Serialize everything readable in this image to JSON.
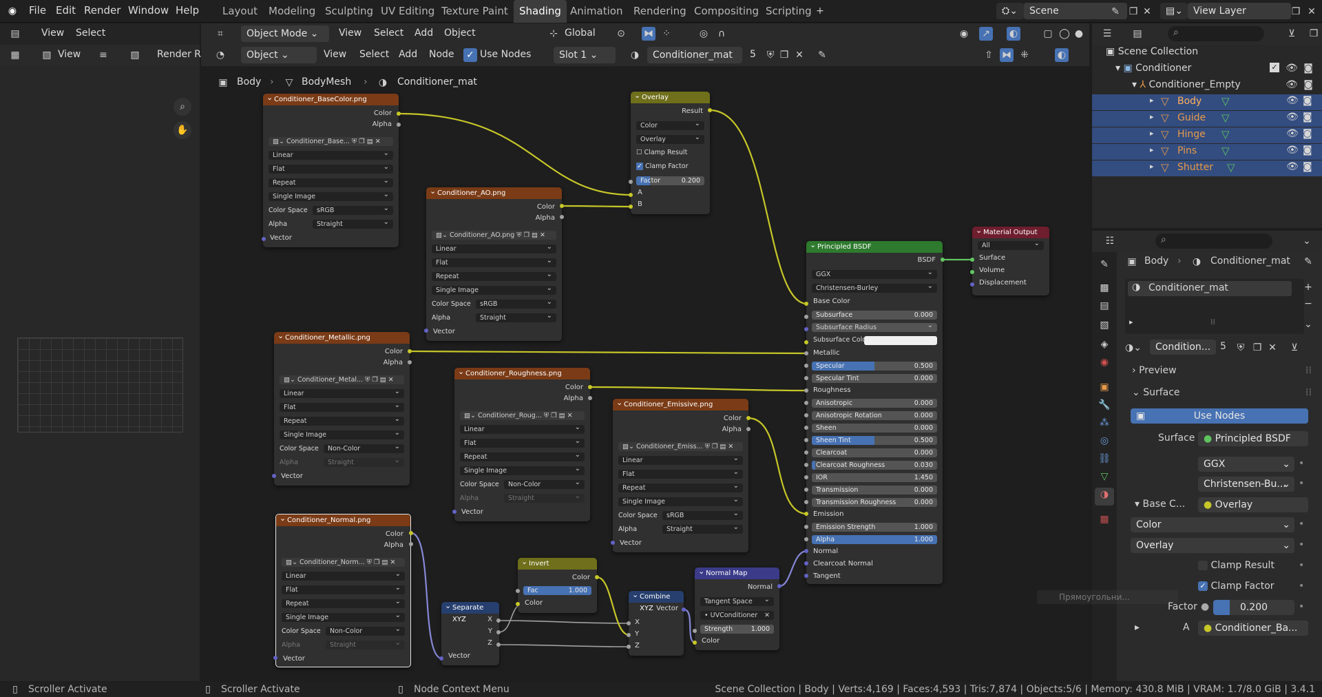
{
  "menu": {
    "file": "File",
    "edit": "Edit",
    "render": "Render",
    "window": "Window",
    "help": "Help"
  },
  "workspaces": [
    "Layout",
    "Modeling",
    "Sculpting",
    "UV Editing",
    "Texture Paint",
    "Shading",
    "Animation",
    "Rendering",
    "Compositing",
    "Scripting"
  ],
  "active_workspace": "Shading",
  "scene": {
    "label": "Scene",
    "view_layer": "View Layer"
  },
  "left_header": {
    "view": "View",
    "select": "Select",
    "view2": "View",
    "render_result": "Render Re"
  },
  "viewport_header": {
    "mode": "Object Mode",
    "view": "View",
    "select": "Select",
    "add": "Add",
    "object": "Object",
    "orientation": "Global"
  },
  "node_header": {
    "type": "Object",
    "view": "View",
    "select": "Select",
    "add": "Add",
    "node": "Node",
    "use_nodes": "Use Nodes",
    "slot": "Slot 1",
    "material": "Conditioner_mat",
    "users": "5"
  },
  "breadcrumb": {
    "object": "Body",
    "mesh": "BodyMesh",
    "material": "Conditioner_mat"
  },
  "nodes": {
    "basecolor": {
      "title": "Conditioner_BaseColor.png",
      "color": "Color",
      "alpha": "Alpha",
      "image": "Conditioner_Base...",
      "interp": "Linear",
      "proj": "Flat",
      "ext": "Repeat",
      "src": "Single Image",
      "cs_label": "Color Space",
      "cs": "sRGB",
      "alpha_label": "Alpha",
      "alpha_mode": "Straight",
      "vector": "Vector"
    },
    "ao": {
      "title": "Conditioner_AO.png",
      "color": "Color",
      "alpha": "Alpha",
      "image": "Conditioner_AO.png",
      "interp": "Linear",
      "proj": "Flat",
      "ext": "Repeat",
      "src": "Single Image",
      "cs_label": "Color Space",
      "cs": "sRGB",
      "alpha_label": "Alpha",
      "alpha_mode": "Straight",
      "vector": "Vector"
    },
    "metallic": {
      "title": "Conditioner_Metallic.png",
      "color": "Color",
      "alpha": "Alpha",
      "image": "Conditioner_Metal...",
      "interp": "Linear",
      "proj": "Flat",
      "ext": "Repeat",
      "src": "Single Image",
      "cs_label": "Color Space",
      "cs": "Non-Color",
      "alpha_label": "Alpha",
      "alpha_mode": "Straight",
      "vector": "Vector"
    },
    "roughness": {
      "title": "Conditioner_Roughness.png",
      "color": "Color",
      "alpha": "Alpha",
      "image": "Conditioner_Roug...",
      "interp": "Linear",
      "proj": "Flat",
      "ext": "Repeat",
      "src": "Single Image",
      "cs_label": "Color Space",
      "cs": "Non-Color",
      "alpha_label": "Alpha",
      "alpha_mode": "Straight",
      "vector": "Vector"
    },
    "emissive": {
      "title": "Conditioner_Emissive.png",
      "color": "Color",
      "alpha": "Alpha",
      "image": "Conditioner_Emiss...",
      "interp": "Linear",
      "proj": "Flat",
      "ext": "Repeat",
      "src": "Single Image",
      "cs_label": "Color Space",
      "cs": "sRGB",
      "alpha_label": "Alpha",
      "alpha_mode": "Straight",
      "vector": "Vector"
    },
    "normal": {
      "title": "Conditioner_Normal.png",
      "color": "Color",
      "alpha": "Alpha",
      "image": "Conditioner_Norm...",
      "interp": "Linear",
      "proj": "Flat",
      "ext": "Repeat",
      "src": "Single Image",
      "cs_label": "Color Space",
      "cs": "Non-Color",
      "alpha_label": "Alpha",
      "alpha_mode": "Straight",
      "vector": "Vector"
    },
    "overlay": {
      "title": "Overlay",
      "result": "Result",
      "type": "Color",
      "blend": "Overlay",
      "clamp_result": "Clamp Result",
      "clamp_factor": "Clamp Factor",
      "factor_label": "Factor",
      "factor": "0.200",
      "a": "A",
      "b": "B"
    },
    "invert": {
      "title": "Invert",
      "color": "Color",
      "fac_label": "Fac",
      "fac": "1.000",
      "color_in": "Color"
    },
    "separate": {
      "title": "Separate XYZ",
      "x": "X",
      "y": "Y",
      "z": "Z",
      "vector": "Vector"
    },
    "combine": {
      "title": "Combine XYZ",
      "vector": "Vector",
      "x": "X",
      "y": "Y",
      "z": "Z"
    },
    "normalmap": {
      "title": "Normal Map",
      "normal": "Normal",
      "space": "Tangent Space",
      "uv": "UVConditioner",
      "strength_label": "Strength",
      "strength": "1.000",
      "color": "Color"
    },
    "output": {
      "title": "Material Output",
      "target": "All",
      "surface": "Surface",
      "volume": "Volume",
      "displacement": "Displacement"
    },
    "bsdf": {
      "title": "Principled BSDF",
      "bsdf": "BSDF",
      "dist": "GGX",
      "sss": "Christensen-Burley",
      "base_color": "Base Color",
      "subsurface": {
        "label": "Subsurface",
        "value": "0.000"
      },
      "subsurface_radius": "Subsurface Radius",
      "subsurface_color": "Subsurface Color",
      "metallic": "Metallic",
      "specular": {
        "label": "Specular",
        "value": "0.500",
        "fill": 0.5
      },
      "specular_tint": {
        "label": "Specular Tint",
        "value": "0.000"
      },
      "roughness": "Roughness",
      "anisotropic": {
        "label": "Anisotropic",
        "value": "0.000"
      },
      "anisotropic_rotation": {
        "label": "Anisotropic Rotation",
        "value": "0.000"
      },
      "sheen": {
        "label": "Sheen",
        "value": "0.000"
      },
      "sheen_tint": {
        "label": "Sheen Tint",
        "value": "0.500",
        "fill": 0.5
      },
      "clearcoat": {
        "label": "Clearcoat",
        "value": "0.000"
      },
      "clearcoat_roughness": {
        "label": "Clearcoat Roughness",
        "value": "0.030",
        "fill": 0.03
      },
      "ior": {
        "label": "IOR",
        "value": "1.450"
      },
      "transmission": {
        "label": "Transmission",
        "value": "0.000"
      },
      "transmission_roughness": {
        "label": "Transmission Roughness",
        "value": "0.000"
      },
      "emission": "Emission",
      "emission_strength": {
        "label": "Emission Strength",
        "value": "1.000"
      },
      "alpha": {
        "label": "Alpha",
        "value": "1.000",
        "fill": 1
      },
      "normal": "Normal",
      "clearcoat_normal": "Clearcoat Normal",
      "tangent": "Tangent"
    }
  },
  "outliner": {
    "root": "Scene Collection",
    "collection": "Conditioner",
    "empty": "Conditioner_Empty",
    "children": [
      "Body",
      "Guide",
      "Hinge",
      "Pins",
      "Shutter"
    ]
  },
  "properties": {
    "breadcrumb_object": "Body",
    "breadcrumb_material": "Conditioner_mat",
    "slot_material": "Conditioner_mat",
    "material_field": "Condition...",
    "users": "5",
    "preview": "Preview",
    "surface_section": "Surface",
    "use_nodes": "Use Nodes",
    "surface_label": "Surface",
    "surface_value": "Principled BSDF",
    "dist": "GGX",
    "sss": "Christensen-Bu...",
    "base_color_label": "Base C...",
    "base_color_value": "Overlay",
    "color": "Color",
    "overlay": "Overlay",
    "clamp_result": "Clamp Result",
    "clamp_factor": "Clamp Factor",
    "factor_label": "Factor",
    "factor": "0.200",
    "a_label": "A",
    "a_value": "Conditioner_Ba...",
    "tooltip": "Прямоугольни..."
  },
  "status": {
    "left1": "Scroller Activate",
    "left2": "Scroller Activate",
    "left3": "Node Context Menu",
    "stats": "Scene Collection | Body | Verts:4,169 | Faces:4,593 | Tris:7,874 | Objects:5/6 | Memory: 430.8 MiB | VRAM: 1.7/8.0 GiB | 3.4.1"
  },
  "colors": {
    "image_header": "#7a3b16",
    "mix_header": "#6f6f1c",
    "vector_header": "#263f6e",
    "shader_header": "#2e7a2e",
    "output_header": "#6e1e2e",
    "selection": "#334d80",
    "accent": "#4772b3"
  }
}
